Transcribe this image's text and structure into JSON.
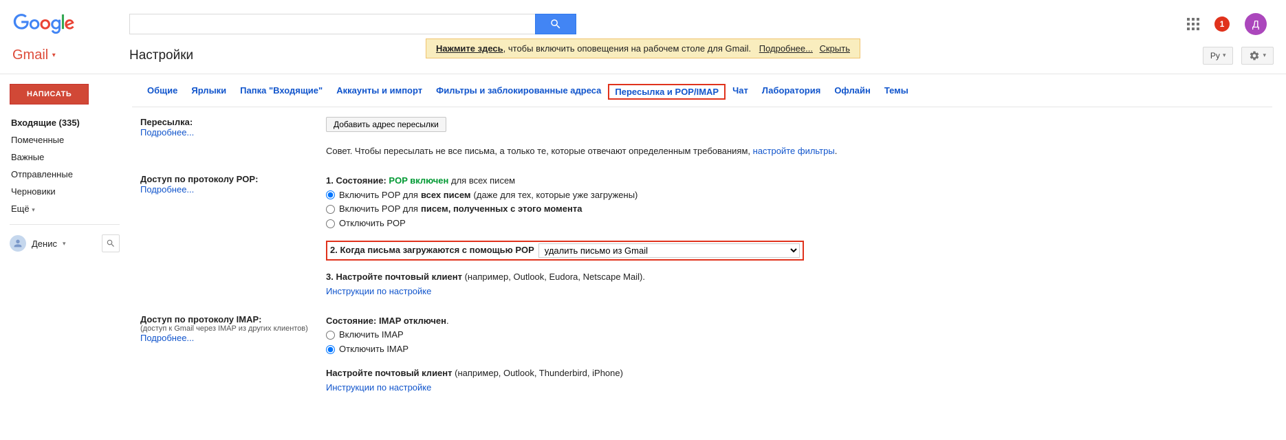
{
  "header": {
    "search_placeholder": "",
    "notif_count": "1",
    "avatar_letter": "Д"
  },
  "banner": {
    "click_here": "Нажмите здесь",
    "rest": ", чтобы включить оповещения на рабочем столе для Gmail.",
    "more": "Подробнее...",
    "hide": "Скрыть"
  },
  "row2": {
    "gmail": "Gmail",
    "title": "Настройки",
    "lang": "Ру"
  },
  "sidebar": {
    "compose": "НАПИСАТЬ",
    "items": [
      "Входящие (335)",
      "Помеченные",
      "Важные",
      "Отправленные",
      "Черновики"
    ],
    "more": "Ещё",
    "user": "Денис"
  },
  "tabs": [
    "Общие",
    "Ярлыки",
    "Папка \"Входящие\"",
    "Аккаунты и импорт",
    "Фильтры и заблокированные адреса",
    "Пересылка и POP/IMAP",
    "Чат",
    "Лаборатория",
    "Офлайн",
    "Темы"
  ],
  "forwarding": {
    "title": "Пересылка:",
    "learn": "Подробнее...",
    "add_btn": "Добавить адрес пересылки",
    "tip_prefix": "Совет. Чтобы пересылать не все письма, а только те, которые отвечают определенным требованиям, ",
    "tip_link": "настройте фильтры",
    "tip_suffix": "."
  },
  "pop": {
    "title": "Доступ по протоколу POP:",
    "learn": "Подробнее...",
    "s1_label": "1. Состояние: ",
    "s1_state": "POP включен",
    "s1_tail": " для всех писем",
    "r1a": "Включить POP для ",
    "r1b": "всех писем",
    "r1c": " (даже для тех, которые уже загружены)",
    "r2a": "Включить POP для ",
    "r2b": "писем, полученных с этого момента",
    "r3": "Отключить POP",
    "s2_label": "2. Когда письма загружаются с помощью POP",
    "s2_select": "удалить письмо из Gmail",
    "s3_label": "3. Настройте почтовый клиент",
    "s3_tail": " (например, Outlook, Eudora, Netscape Mail).",
    "s3_link": "Инструкции по настройке"
  },
  "imap": {
    "title": "Доступ по протоколу IMAP:",
    "sub": "(доступ к Gmail через IMAP из других клиентов)",
    "learn": "Подробнее...",
    "state_label": "Состояние: ",
    "state_val": "IMAP отключен",
    "r1": "Включить IMAP",
    "r2": "Отключить IMAP",
    "conf_label": "Настройте почтовый клиент",
    "conf_tail": " (например, Outlook, Thunderbird, iPhone)",
    "conf_link": "Инструкции по настройке"
  }
}
